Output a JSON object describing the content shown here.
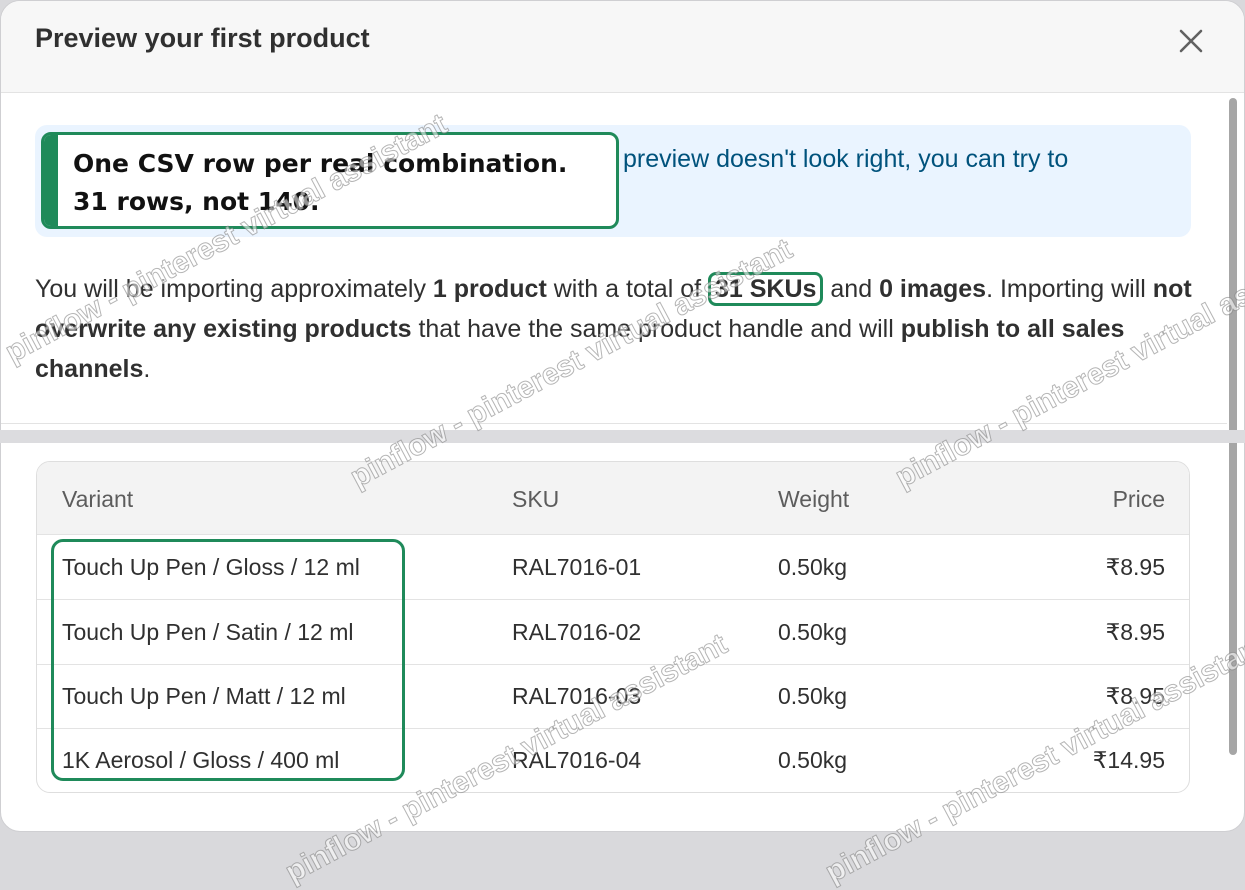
{
  "modal": {
    "title": "Preview your first product",
    "close_icon": "close-icon"
  },
  "banner": {
    "partial_text": "preview doesn't look right, you can try to"
  },
  "callout": {
    "line1": "One CSV row per real combination.",
    "line2": "31 rows, not 140."
  },
  "summary": {
    "t1": "You will be importing approximately ",
    "b1": "1 product",
    "t2": " with a total of ",
    "b2": "31 SKUs",
    "t3": " and ",
    "b3": "0 images",
    "t4": ". Importing will ",
    "b4": "not overwrite any existing products",
    "t5": " that have the same product handle and will ",
    "b5": "publish to all sales channels",
    "t6": "."
  },
  "table": {
    "headers": {
      "variant": "Variant",
      "sku": "SKU",
      "weight": "Weight",
      "price": "Price"
    },
    "rows": [
      {
        "variant": "Touch Up Pen / Gloss / 12 ml",
        "sku": "RAL7016-01",
        "weight": "0.50kg",
        "price": "₹8.95"
      },
      {
        "variant": "Touch Up Pen / Satin / 12 ml",
        "sku": "RAL7016-02",
        "weight": "0.50kg",
        "price": "₹8.95"
      },
      {
        "variant": "Touch Up Pen / Matt / 12 ml",
        "sku": "RAL7016-03",
        "weight": "0.50kg",
        "price": "₹8.95"
      },
      {
        "variant": "1K Aerosol / Gloss / 400 ml",
        "sku": "RAL7016-04",
        "weight": "0.50kg",
        "price": "₹14.95"
      }
    ]
  },
  "watermark": "pinflow - pinterest virtual assistant",
  "colors": {
    "highlight": "#1f8a5a",
    "banner_bg": "#eaf4ff",
    "banner_text": "#00527c"
  }
}
